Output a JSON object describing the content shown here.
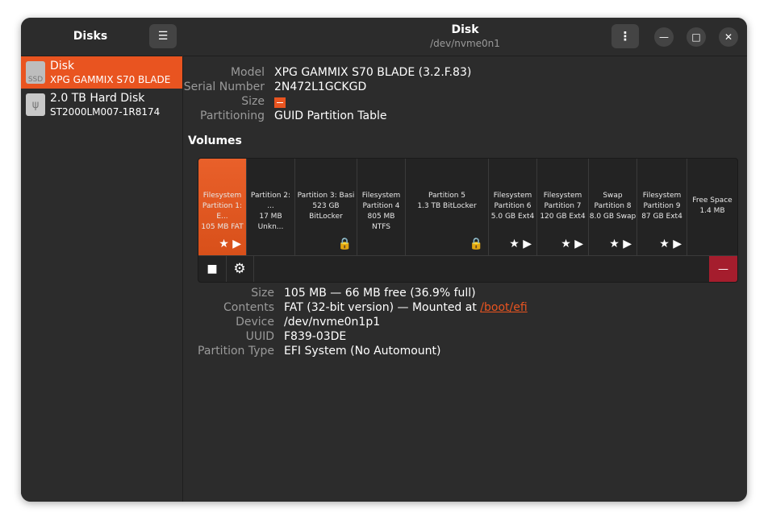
{
  "sidebar": {
    "title": "Disks",
    "menu_icon": "hamburger-icon",
    "devices": [
      {
        "name": "Disk",
        "model": "XPG GAMMIX S70 BLADE",
        "icon_label": "SSD"
      },
      {
        "name": "2.0 TB Hard Disk",
        "model": "ST2000LM007-1R8174",
        "icon_label": "ψ"
      }
    ]
  },
  "header": {
    "title": "Disk",
    "subtitle": "/dev/nvme0n1",
    "kebab": "⋮",
    "minimize": "—",
    "maximize": "□",
    "close": "✕"
  },
  "disk_info": {
    "model_label": "Model",
    "model_value": "XPG GAMMIX S70 BLADE (3.2.F.83)",
    "serial_label": "Serial Number",
    "serial_value": "2N472L1GCKGD",
    "size_label": "Size",
    "partitioning_label": "Partitioning",
    "partitioning_value": "GUID Partition Table"
  },
  "volumes": {
    "title": "Volumes",
    "partitions": [
      {
        "text": "Filesystem\nPartition 1: E...\n105 MB FAT",
        "icons": "★ ▶"
      },
      {
        "text": "Partition 2: ...\n17 MB Unkn...",
        "icons": ""
      },
      {
        "text": "Partition 3: Basi\n523 GB BitLocker",
        "icons": "🔒"
      },
      {
        "text": "Filesystem\nPartition 4\n805 MB NTFS",
        "icons": ""
      },
      {
        "text": "Partition 5\n1.3 TB BitLocker",
        "icons": "🔒"
      },
      {
        "text": "Filesystem\nPartition 6\n5.0 GB Ext4",
        "icons": "★ ▶"
      },
      {
        "text": "Filesystem\nPartition 7\n120 GB Ext4",
        "icons": "★ ▶"
      },
      {
        "text": "Swap\nPartition 8\n8.0 GB Swap",
        "icons": "★ ▶"
      },
      {
        "text": "Filesystem\nPartition 9\n87 GB Ext4",
        "icons": "★ ▶"
      },
      {
        "text": "Free Space\n1.4 MB",
        "icons": ""
      }
    ],
    "stop_icon": "■",
    "gear_icon": "⚙",
    "delete_icon": "—"
  },
  "partition_info": {
    "size_label": "Size",
    "size_value": "105 MB — 66 MB free (36.9% full)",
    "contents_label": "Contents",
    "contents_prefix": "FAT (32-bit version) — Mounted at ",
    "contents_link": "/boot/efi",
    "device_label": "Device",
    "device_value": "/dev/nvme0n1p1",
    "uuid_label": "UUID",
    "uuid_value": "F839-03DE",
    "ptype_label": "Partition Type",
    "ptype_value": "EFI System (No Automount)"
  },
  "colors": {
    "accent": "#e95420",
    "destructive": "#a51d2d",
    "window_bg": "#2c2c2c"
  }
}
